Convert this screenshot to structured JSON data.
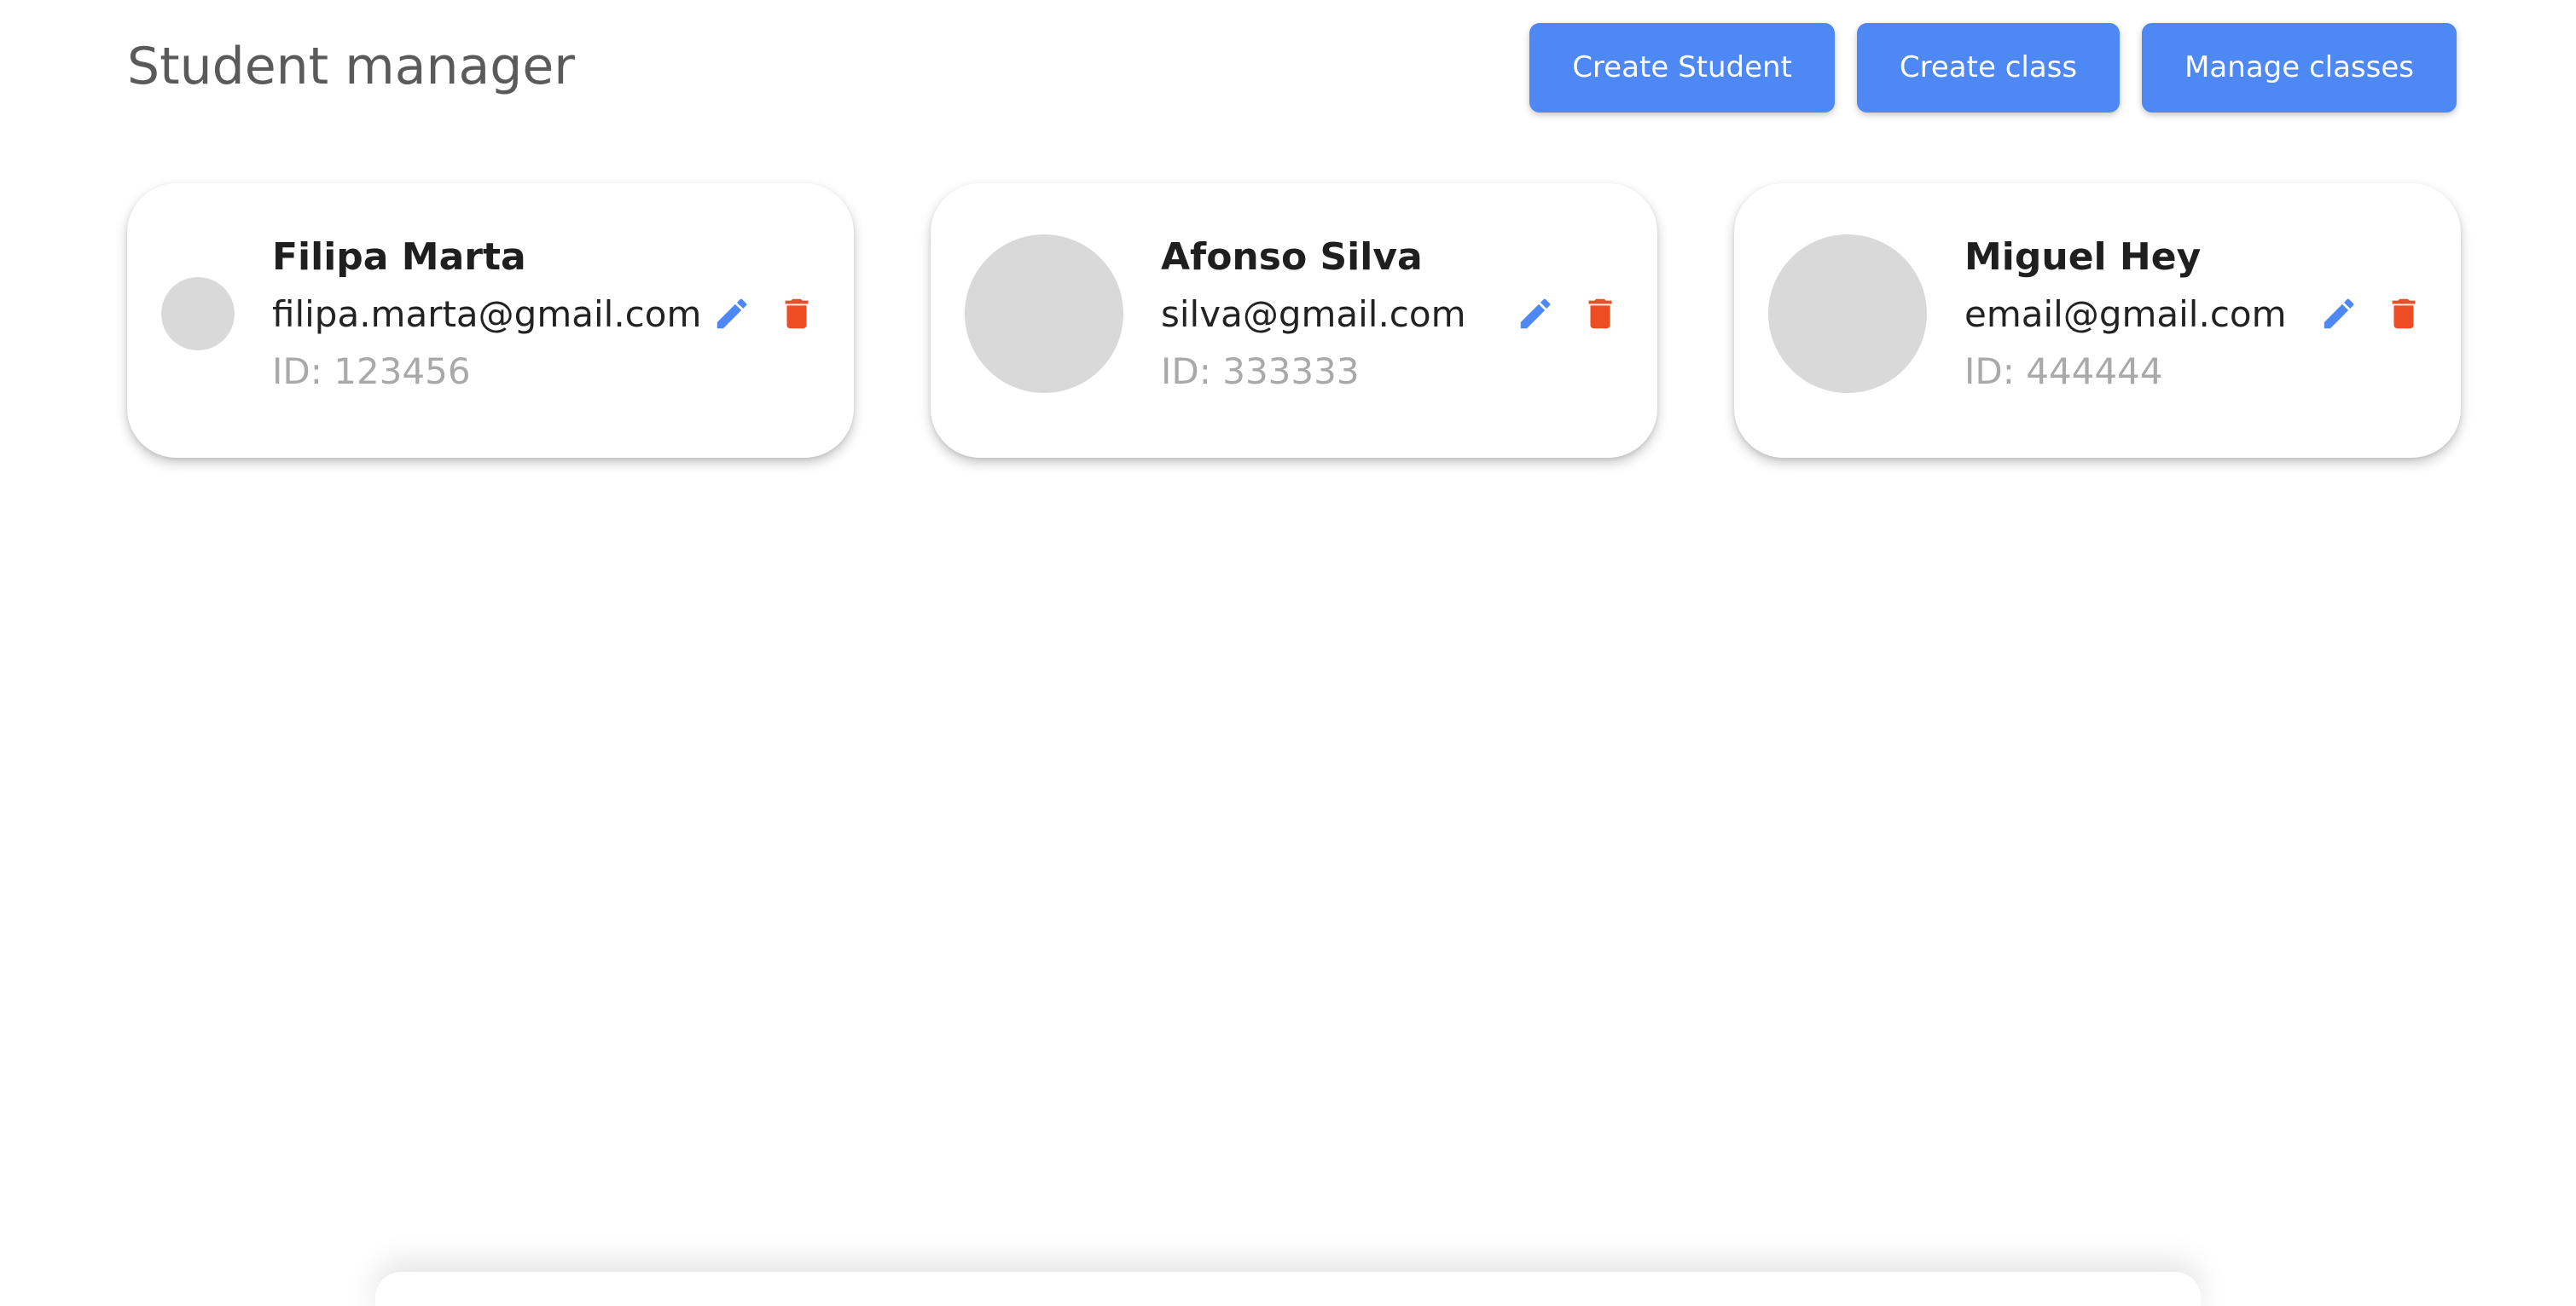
{
  "header": {
    "title": "Student manager",
    "buttons": [
      {
        "label": "Create Student"
      },
      {
        "label": "Create class"
      },
      {
        "label": "Manage classes"
      }
    ]
  },
  "students": [
    {
      "name": "Filipa Marta",
      "email": "filipa.marta@gmail.com",
      "id_text": "ID: 123456",
      "avatar": "placeholder"
    },
    {
      "name": "Afonso Silva",
      "email": "silva@gmail.com",
      "id_text": "ID: 333333",
      "avatar": "placeholder"
    },
    {
      "name": "Miguel Hey",
      "email": "email@gmail.com",
      "id_text": "ID: 444444",
      "avatar": "placeholder"
    }
  ],
  "icons": {
    "edit": "pencil-icon",
    "delete": "trash-icon"
  },
  "colors": {
    "accent": "#4d88f5",
    "edit_icon": "#4d88f5",
    "delete_icon": "#ee4c22",
    "avatar_placeholder": "#d9d9d9",
    "title_text": "#5a5a5a",
    "id_text": "#a9a9a9"
  }
}
